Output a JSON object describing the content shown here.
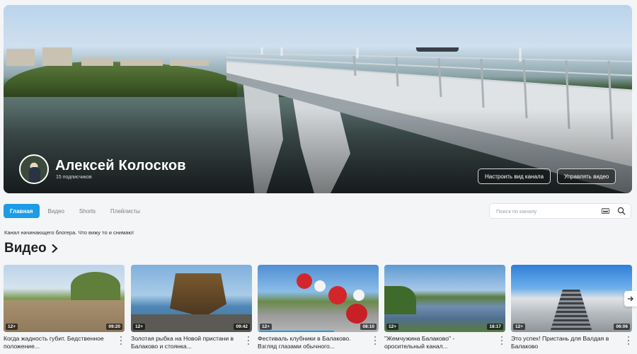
{
  "channel": {
    "name": "Алексей Колосков",
    "subscribers": "15 подписчиков",
    "description": "Канал начинающего блогера. Что вижу то и снимаю!"
  },
  "banner_buttons": {
    "customize": "Настроить вид канала",
    "manage": "Управлять видео"
  },
  "tabs": [
    {
      "label": "Главная",
      "active": true
    },
    {
      "label": "Видео",
      "active": false
    },
    {
      "label": "Shorts",
      "active": false
    },
    {
      "label": "Плейлисты",
      "active": false
    }
  ],
  "search": {
    "placeholder": "Поиск по каналу"
  },
  "section": {
    "title": "Видео"
  },
  "videos": [
    {
      "title": "Когда жадность губит. Бедственное положение...",
      "age": "12+",
      "duration": "09:20",
      "progress": 0
    },
    {
      "title": "Золотая рыбка на Новой пристани в Балаково и стоянка...",
      "age": "12+",
      "duration": "09:42",
      "progress": 0
    },
    {
      "title": "Фестиваль клубники в Балаково. Взгляд глазами обычного...",
      "age": "12+",
      "duration": "08:10",
      "progress": 0.63
    },
    {
      "title": "\"Жемчужина Балаково\" - оросительный канал...",
      "age": "12+",
      "duration": "18:17",
      "progress": 0
    },
    {
      "title": "Это успех! Пристань для Валдая в Балаково",
      "age": "12+",
      "duration": "06:06",
      "progress": 0
    }
  ],
  "colors": {
    "accent": "#1c9be7"
  }
}
